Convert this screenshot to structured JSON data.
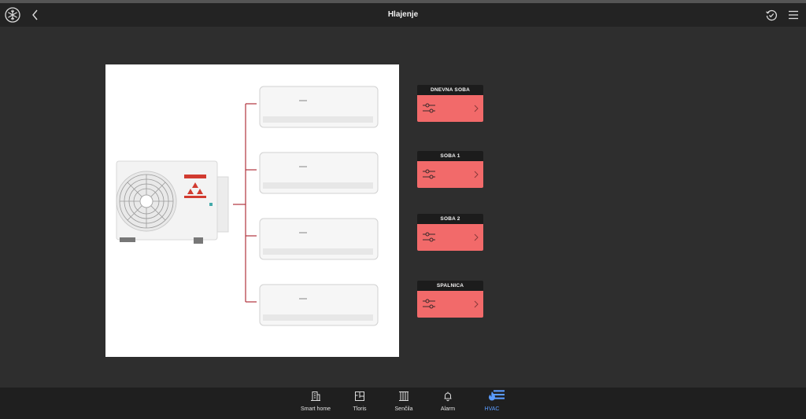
{
  "header": {
    "title": "Hlajenje"
  },
  "rooms": [
    {
      "name": "DNEVNA SOBA"
    },
    {
      "name": "SOBA 1"
    },
    {
      "name": "SOBA 2"
    },
    {
      "name": "SPALNICA"
    }
  ],
  "diagram": {
    "brand_text": "INVERTER"
  },
  "nav": [
    {
      "label": "Smart home",
      "icon": "building-icon"
    },
    {
      "label": "Tloris",
      "icon": "floorplan-icon"
    },
    {
      "label": "Senčila",
      "icon": "blinds-icon"
    },
    {
      "label": "Alarm",
      "icon": "bell-icon"
    },
    {
      "label": "HVAC",
      "icon": "flame-icon",
      "active": true
    }
  ],
  "colors": {
    "card": "#f26a6a",
    "active": "#5b9cff",
    "pipe": "#b0323c"
  }
}
